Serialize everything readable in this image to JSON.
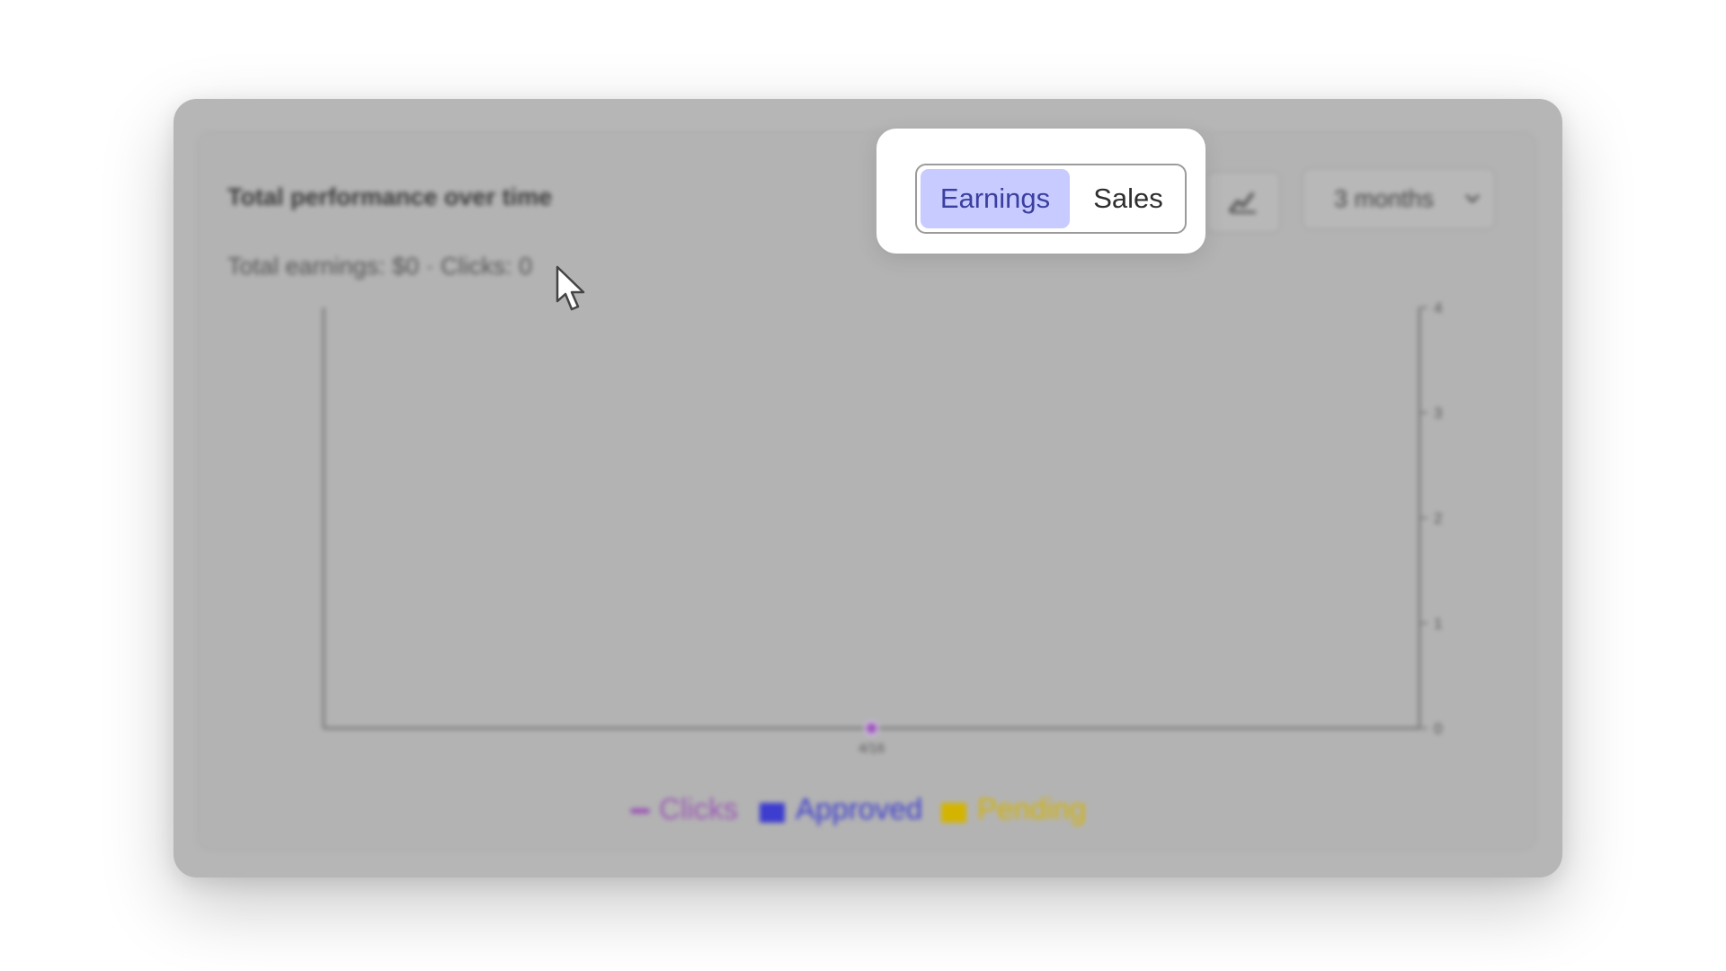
{
  "card": {
    "title": "Total performance over time",
    "subtitle": "Total earnings: $0 · Clicks: 0"
  },
  "toggle": {
    "earnings_label": "Earnings",
    "sales_label": "Sales",
    "selected": "Earnings"
  },
  "chart_type_button": {
    "icon": "chart-line-icon"
  },
  "range_select": {
    "value": "3 months",
    "icon": "chevron-down-icon"
  },
  "chart_data": {
    "type": "line",
    "x": [
      "4/16"
    ],
    "series": [
      {
        "name": "Clicks",
        "type": "line",
        "values": [
          0
        ],
        "color": "#9b59b6"
      },
      {
        "name": "Approved",
        "type": "bar",
        "values": [
          0
        ],
        "color": "#3d3dcf"
      },
      {
        "name": "Pending",
        "type": "bar",
        "values": [
          0
        ],
        "color": "#d4b400"
      }
    ],
    "right_axis": {
      "ticks": [
        "0",
        "1",
        "2",
        "3",
        "4"
      ],
      "ylim": [
        0,
        4
      ]
    },
    "legend_position": "bottom-center"
  },
  "legend": {
    "items": [
      {
        "label": "Clicks",
        "color": "#9b59b6"
      },
      {
        "label": "Approved",
        "color": "#3d3dcf"
      },
      {
        "label": "Pending",
        "color": "#d4b400"
      }
    ]
  },
  "colors": {
    "overlay": "#b6b6b6",
    "toggle_active_bg": "#c8cbff",
    "toggle_active_text": "#3b3f9e"
  }
}
